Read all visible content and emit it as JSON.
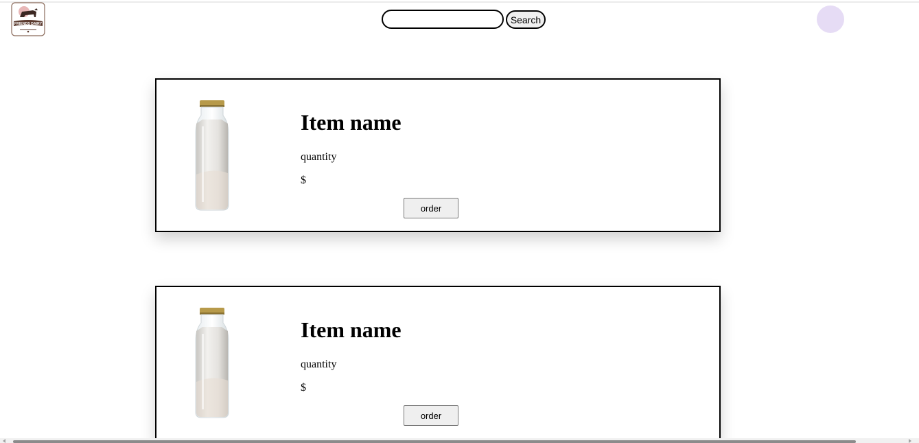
{
  "header": {
    "logo_text": "FRIENDS DAIRY",
    "search": {
      "value": "",
      "placeholder": ""
    },
    "search_button_label": "Search"
  },
  "colors": {
    "avatar": "#e6dcf5",
    "logo_brown": "#5b3a2e",
    "logo_pink": "#d9a8a8"
  },
  "products": [
    {
      "name": "Item name",
      "quantity_label": "quantity",
      "price_label": "$",
      "order_label": "order",
      "image_icon": "milk-bottle"
    },
    {
      "name": "Item name",
      "quantity_label": "quantity",
      "price_label": "$",
      "order_label": "order",
      "image_icon": "milk-bottle"
    }
  ]
}
